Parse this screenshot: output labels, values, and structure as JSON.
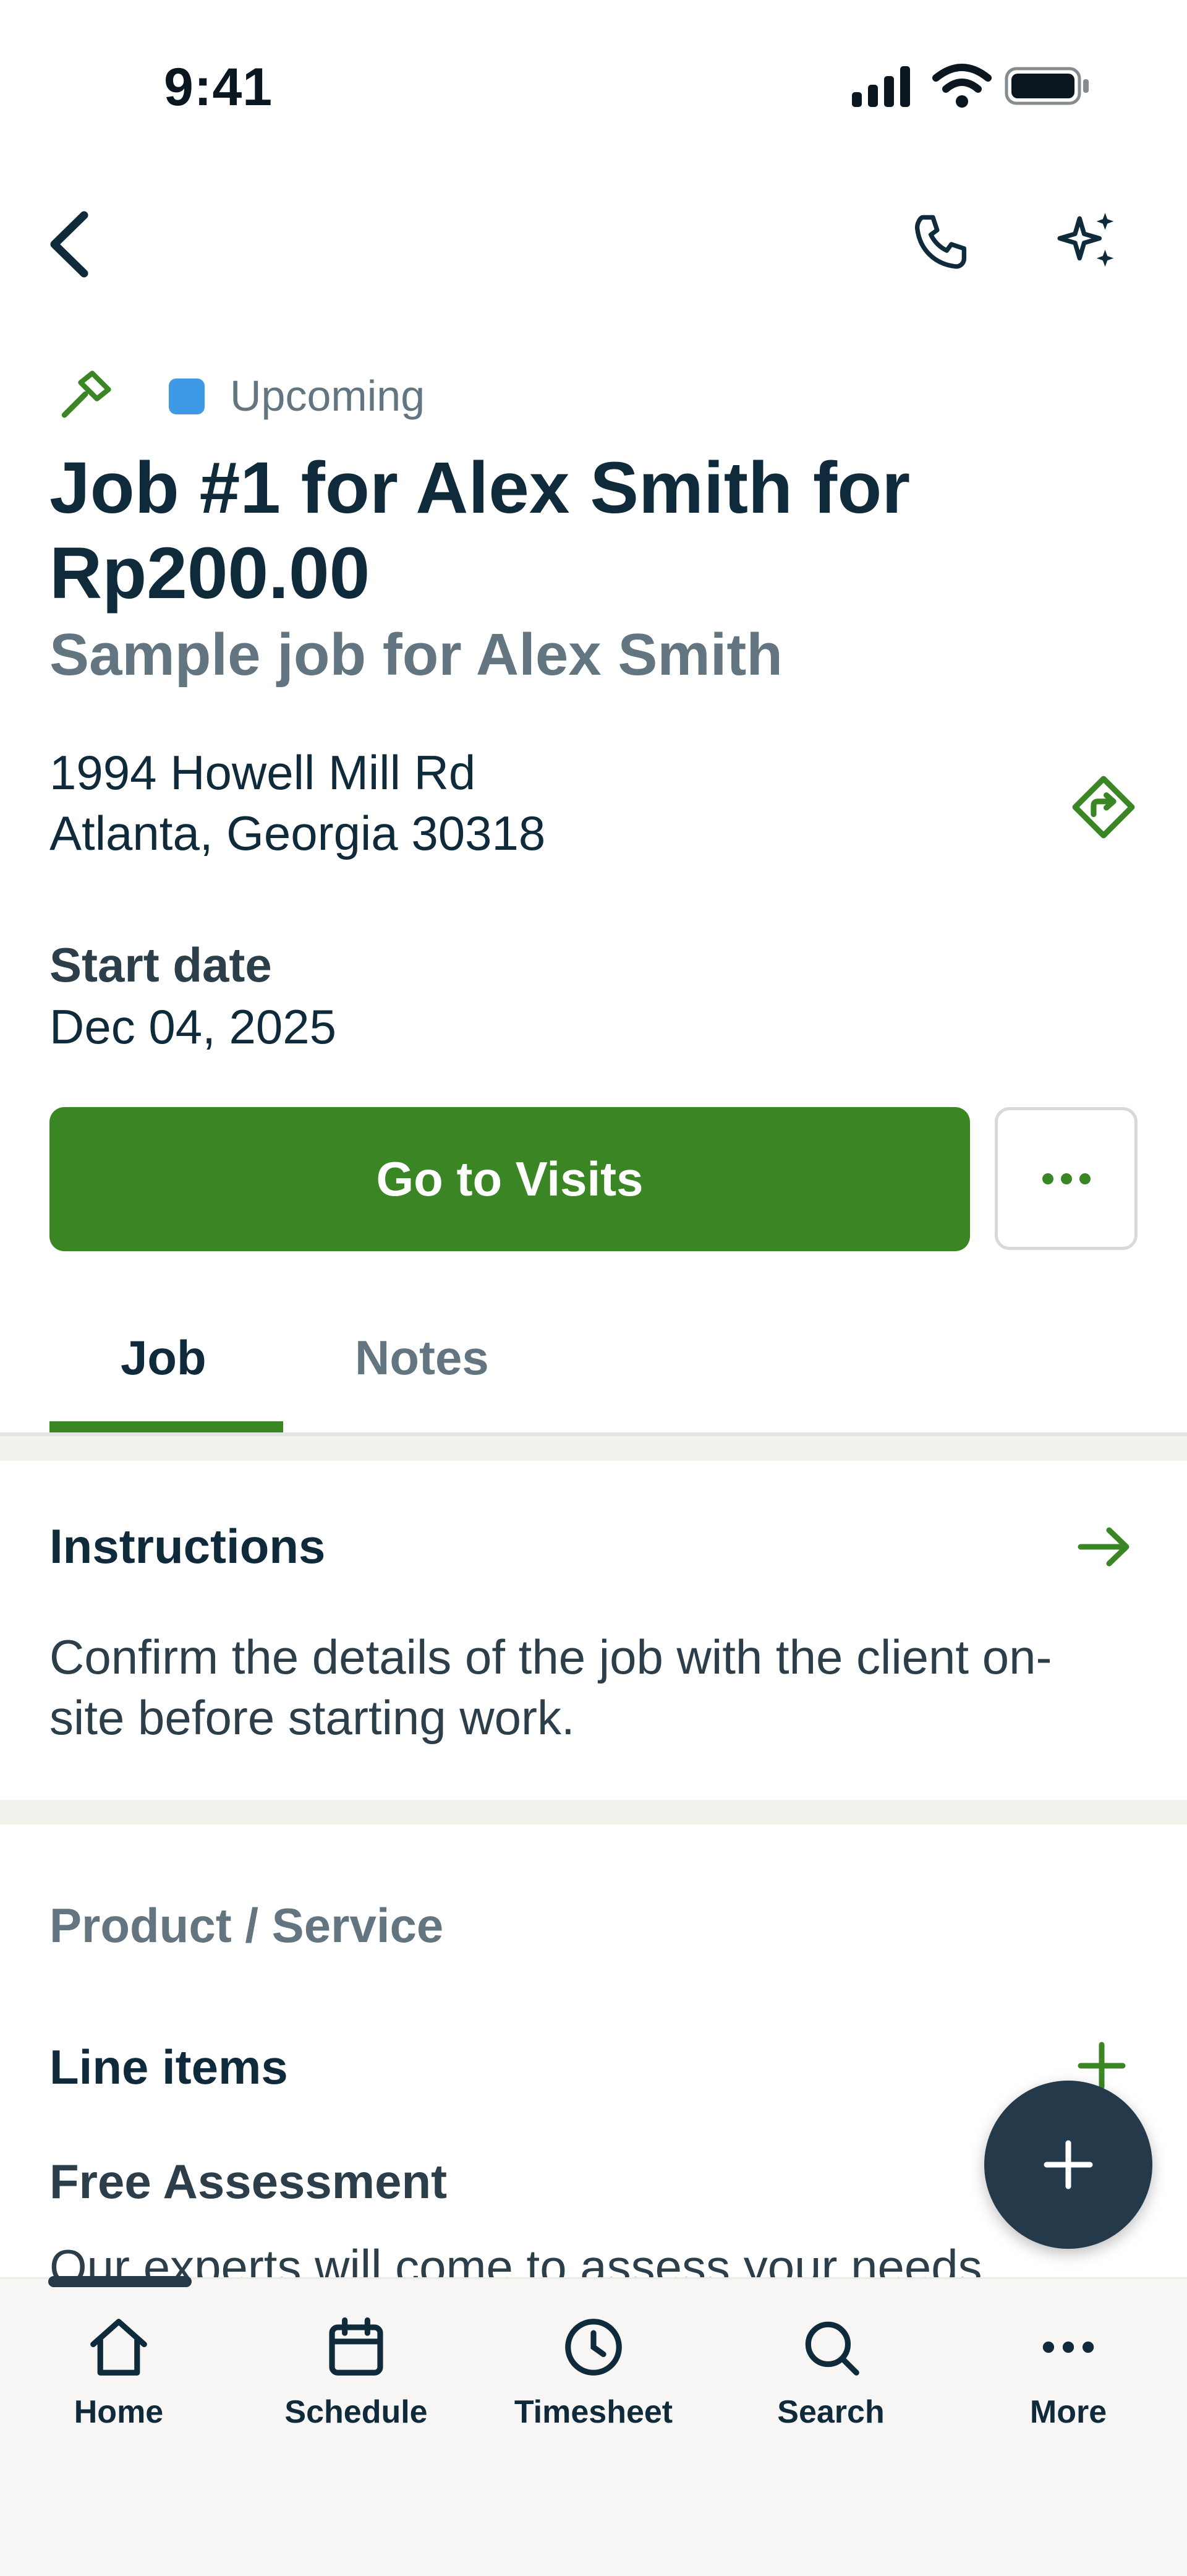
{
  "status_bar": {
    "time": "9:41"
  },
  "job": {
    "status": "Upcoming",
    "status_color": "#3e9ae6",
    "title": "Job #1 for Alex Smith for Rp200.00",
    "subtitle": "Sample job for Alex Smith",
    "address_line1": "1994 Howell Mill Rd",
    "address_line2": "Atlanta, Georgia 30318",
    "start_date_label": "Start date",
    "start_date_value": "Dec 04, 2025"
  },
  "actions": {
    "primary_label": "Go to Visits",
    "more_icon": "ellipsis-icon"
  },
  "tabs": [
    {
      "label": "Job",
      "active": true
    },
    {
      "label": "Notes",
      "active": false
    }
  ],
  "instructions": {
    "title": "Instructions",
    "text": "Confirm the details of the job with the client on-site before starting work."
  },
  "products": {
    "section_label": "Product / Service",
    "line_items_title": "Line items",
    "items": [
      {
        "name": "Free Assessment",
        "description": "Our experts will come to assess your needs"
      }
    ]
  },
  "bottom_nav": [
    {
      "label": "Home",
      "icon": "home-icon"
    },
    {
      "label": "Schedule",
      "icon": "calendar-icon"
    },
    {
      "label": "Timesheet",
      "icon": "clock-icon"
    },
    {
      "label": "Search",
      "icon": "search-icon"
    },
    {
      "label": "More",
      "icon": "ellipsis-icon"
    }
  ],
  "colors": {
    "accent": "#3b8624",
    "primary_text": "#0f2a3a",
    "muted_text": "#637580",
    "fab": "#24394a"
  }
}
